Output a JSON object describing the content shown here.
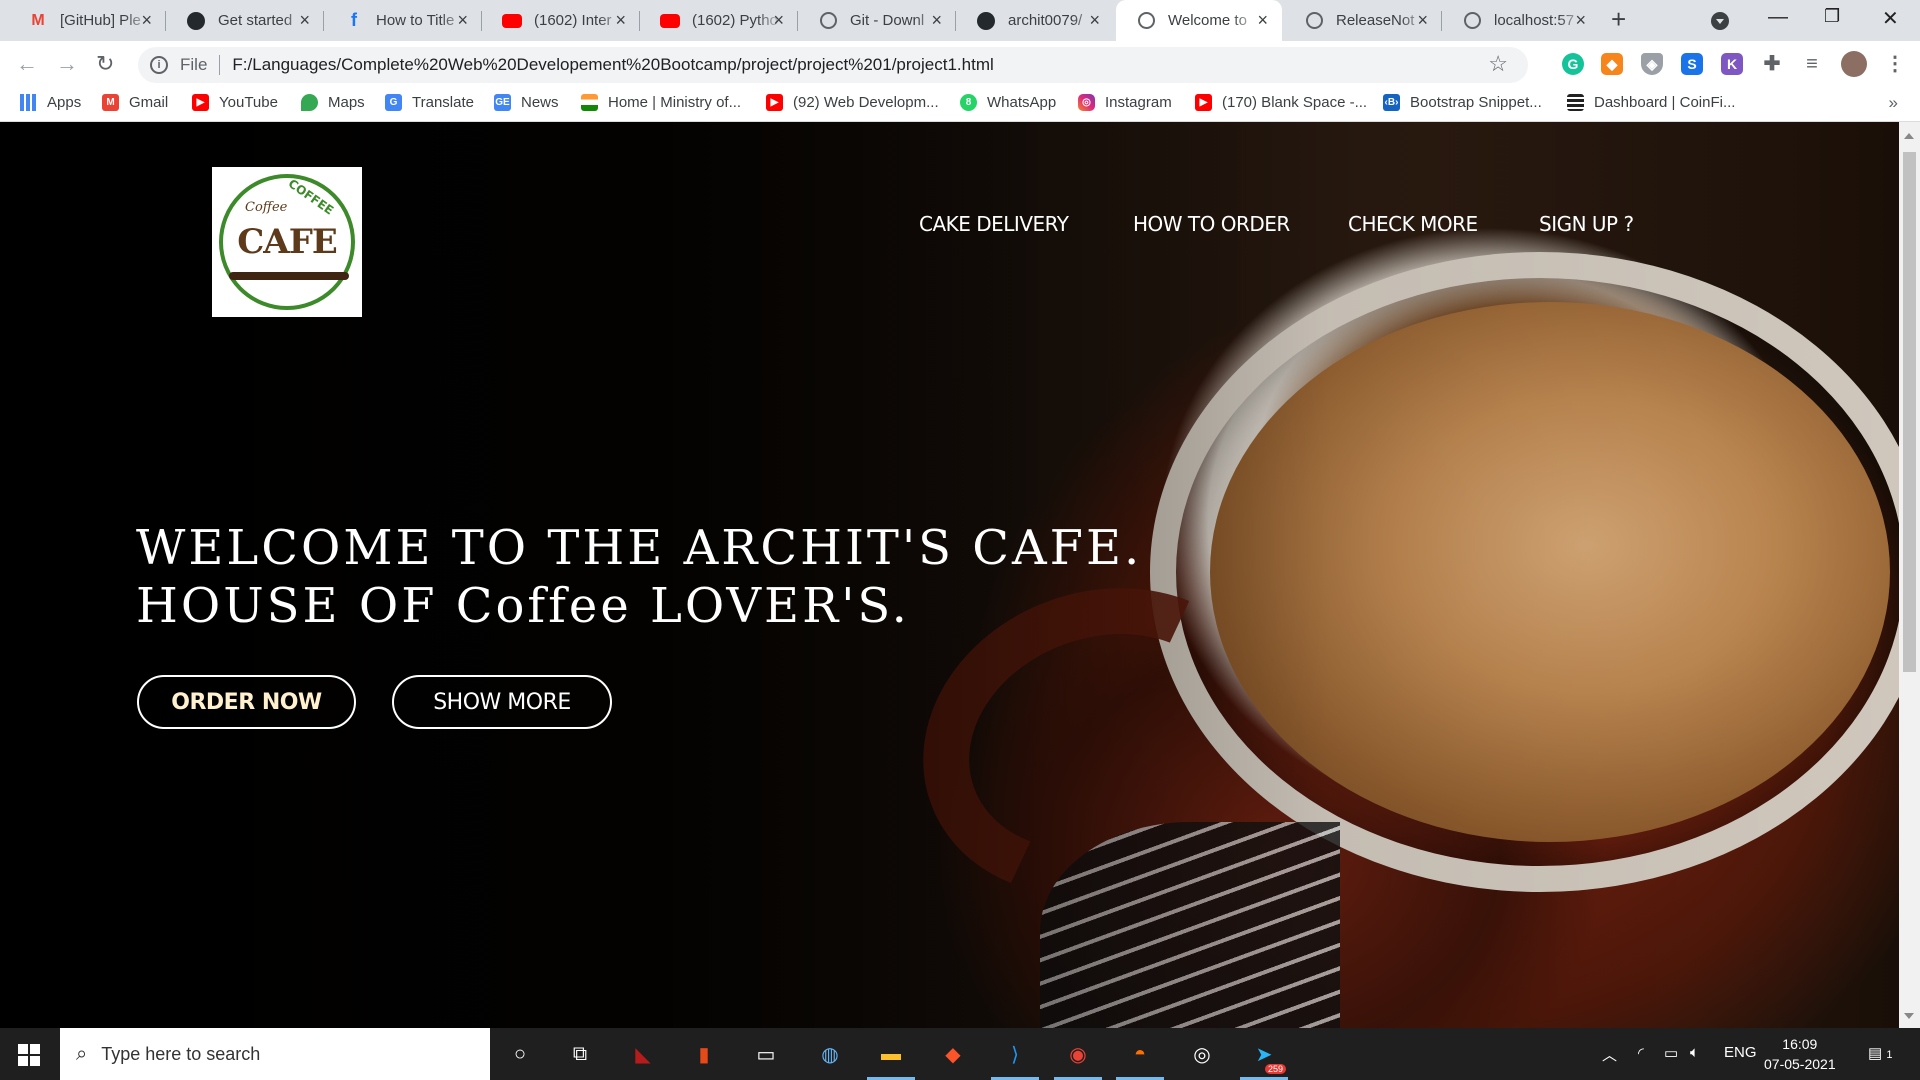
{
  "browser": {
    "tabs": [
      {
        "title": "[GitHub] Ple",
        "icon": "gmail-icon",
        "icon_color": "#EA4335"
      },
      {
        "title": "Get started",
        "icon": "github-icon",
        "icon_color": "#24292e"
      },
      {
        "title": "How to Title",
        "icon": "facebook-icon",
        "icon_color": "#1877F2"
      },
      {
        "title": "(1602) Inter",
        "icon": "youtube-icon",
        "icon_color": "#FF0000"
      },
      {
        "title": "(1602) Pytho",
        "icon": "youtube-icon",
        "icon_color": "#FF0000"
      },
      {
        "title": "Git - Downl",
        "icon": "globe-icon",
        "icon_color": "#5f6368"
      },
      {
        "title": "archit0079/",
        "icon": "github-icon",
        "icon_color": "#24292e"
      },
      {
        "title": "Welcome to",
        "icon": "globe-icon",
        "icon_color": "#5f6368",
        "active": true
      },
      {
        "title": "ReleaseNot",
        "icon": "globe-icon",
        "icon_color": "#5f6368"
      },
      {
        "title": "localhost:57",
        "icon": "globe-icon",
        "icon_color": "#5f6368"
      }
    ],
    "new_tab": "+",
    "address": {
      "scheme": "File",
      "url": "F:/Languages/Complete%20Web%20Developement%20Bootcamp/project/project%201/project1.html"
    },
    "bookmarks": [
      {
        "label": "Apps",
        "icon": "apps-grid-icon",
        "color": "#4285F4"
      },
      {
        "label": "Gmail",
        "icon": "gmail-icon",
        "color": "#EA4335"
      },
      {
        "label": "YouTube",
        "icon": "youtube-icon",
        "color": "#FF0000"
      },
      {
        "label": "Maps",
        "icon": "maps-pin-icon",
        "color": "#34A853"
      },
      {
        "label": "Translate",
        "icon": "translate-icon",
        "color": "#4285F4"
      },
      {
        "label": "News",
        "icon": "news-icon",
        "color": "#4285F4"
      },
      {
        "label": "Home | Ministry of...",
        "icon": "india-flag-icon",
        "color": "#FF9933"
      },
      {
        "label": "(92) Web Developm...",
        "icon": "youtube-icon",
        "color": "#FF0000"
      },
      {
        "label": "WhatsApp",
        "icon": "whatsapp-icon",
        "color": "#25D366"
      },
      {
        "label": "Instagram",
        "icon": "instagram-icon",
        "color": "#C13584"
      },
      {
        "label": "(170) Blank Space -...",
        "icon": "youtube-icon",
        "color": "#FF0000"
      },
      {
        "label": "Bootstrap Snippet...",
        "icon": "bootstrap-icon",
        "color": "#1565C0"
      },
      {
        "label": "Dashboard | CoinFi...",
        "icon": "coinfi-icon",
        "color": "#222222"
      }
    ],
    "bookmarks_more": "»"
  },
  "page": {
    "logo": {
      "big": "CAFE",
      "small": "Coffee",
      "top": "COFFEE"
    },
    "nav": [
      "CAKE DELIVERY",
      "HOW TO ORDER",
      "CHECK MORE",
      "SIGN UP ?"
    ],
    "hero": {
      "line1": "WELCOME TO THE ARCHIT'S CAFE.",
      "line2": "HOUSE OF Coffee LOVER'S."
    },
    "buttons": {
      "primary": "ORDER NOW",
      "secondary": "SHOW MORE"
    }
  },
  "taskbar": {
    "search_placeholder": "Type here to search",
    "tray_lang": "ENG",
    "time": "16:09",
    "date": "07-05-2021",
    "notification_count": "1",
    "telegram_badge": "259"
  }
}
